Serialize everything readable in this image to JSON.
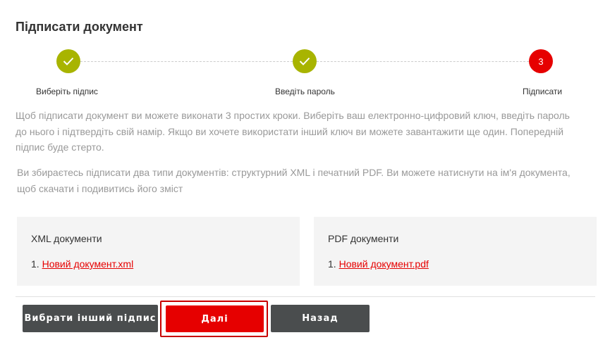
{
  "page": {
    "title": "Підписати документ"
  },
  "stepper": {
    "steps": [
      {
        "label": "Виберіть підпис",
        "state": "done",
        "icon": "check-icon"
      },
      {
        "label": "Введіть пароль",
        "state": "done",
        "icon": "check-icon"
      },
      {
        "label": "Підписати",
        "state": "current",
        "number": "3"
      }
    ]
  },
  "intro": {
    "text": "Щоб підписати документ ви можете виконати 3 простих кроки. Виберіть ваш електронно-цифровий ключ, введіть пароль до нього і підтвердіть свій намір. Якщо ви хочете використати інший ключ ви можете завантажити ще один. Попередній підпис буде стерто.",
    "docs_text": "Ви збираєтесь підписати два типи документів: структурний XML і печатний PDF. Ви можете натиснути на ім'я документа, щоб скачати і подивитись його зміст"
  },
  "documents": {
    "xml": {
      "title": "XML документи",
      "items": [
        {
          "index": "1.",
          "name": "Новий документ.xml"
        }
      ]
    },
    "pdf": {
      "title": "PDF документи",
      "items": [
        {
          "index": "1.",
          "name": "Новий документ.pdf"
        }
      ]
    }
  },
  "actions": {
    "choose_other_label": "Вибрати інший підпис",
    "next_label": "Далі",
    "back_label": "Назад"
  },
  "colors": {
    "accent": "#e60000",
    "done": "#a8b400",
    "button_dark": "#4a4d4e",
    "muted_text": "#999999"
  }
}
